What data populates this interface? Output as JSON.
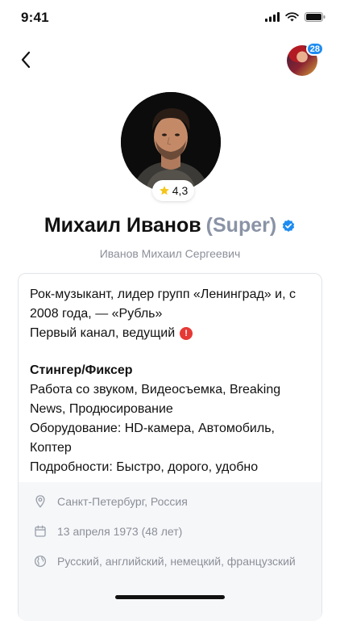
{
  "status": {
    "time": "9:41"
  },
  "nav": {
    "badge_count": "28"
  },
  "profile": {
    "rating": "4,3",
    "name": "Михаил Иванов",
    "tag": "(Super)",
    "full_name": "Иванов Михаил Сергеевич"
  },
  "bio": {
    "line1": "Рок-музыкант, лидер групп «Ленинград» и, с 2008 года, — «Рубль»",
    "line2": "Первый канал, ведущий"
  },
  "services": {
    "title": "Стингер/Фиксер",
    "work": "Работа со звуком, Видеосъемка, Breaking News, Продюсирование",
    "equipment": "Оборудование: HD-камера, Автомобиль, Коптер",
    "details": "Подробности: Быстро, дорого, удобно"
  },
  "info": {
    "location": "Санкт-Петербург, Россия",
    "birthday": "13 апреля 1973 (48 лет)",
    "languages": "Русский, английский, немецкий, французский"
  },
  "colors": {
    "accent_blue": "#1e8cf0",
    "alert_red": "#e53935",
    "muted_text": "#8c8f99"
  }
}
